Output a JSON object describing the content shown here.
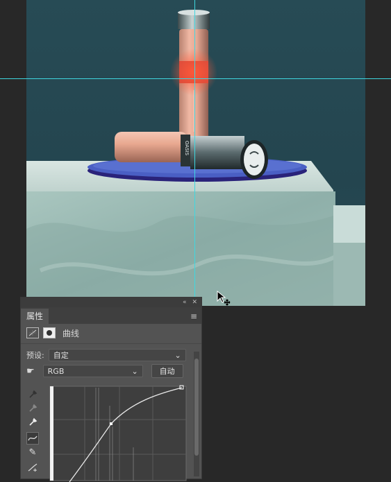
{
  "panel": {
    "collapse_glyph": "«",
    "close_glyph": "✕",
    "tab_label": "属性",
    "menu_glyph": "≡",
    "adjustment_title": "曲线",
    "preset_label": "预设:",
    "preset_value": "自定",
    "channel_value": "RGB",
    "auto_button": "自动"
  },
  "product": {
    "bottle_text": "OASIS"
  },
  "colors": {
    "canvas_bg": "#274b55",
    "guide": "#3fd8e0",
    "platform": "#3c4fb0",
    "stone": "#98b8b2"
  }
}
